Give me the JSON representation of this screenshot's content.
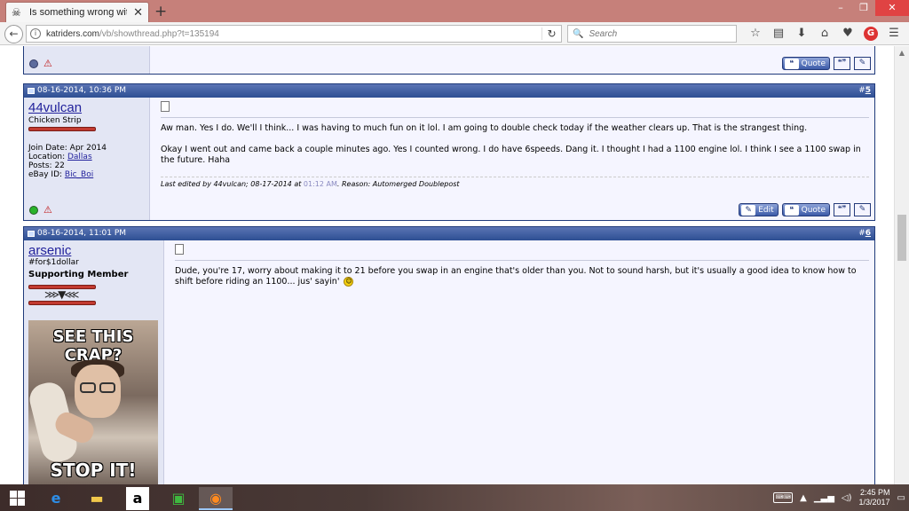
{
  "browser": {
    "tab_title": "Is something wrong with ...",
    "tab_close": "✕",
    "new_tab": "+",
    "url_host": "katriders.com",
    "url_path": "/vb/showthread.php?t=135194",
    "search_placeholder": "Search",
    "window_buttons": [
      "–",
      "❐",
      "✕"
    ]
  },
  "posts": [
    {
      "date": "08-16-2014, 10:36 PM",
      "number": "5",
      "number_prefix": "#",
      "username": "44vulcan",
      "user_title": "Chicken Strip",
      "join_date_label": "Join Date:",
      "join_date": "Apr 2014",
      "location_label": "Location:",
      "location": "Dallas",
      "posts_label": "Posts:",
      "posts": "22",
      "ebay_label": "eBay ID:",
      "ebay_id": "Bic_Boi",
      "paragraphs": [
        "Aw man. Yes I do. We'll I think... I was having to much fun on it lol. I am going to double check today if the weather clears up. That is the strangest thing.",
        "Okay I went out and came back a couple minutes ago. Yes I counted wrong. I do have 6speeds. Dang it. I thought I had a 1100 engine lol. I think I see a 1100 swap in the future. Haha"
      ],
      "edit_prefix": "Last edited by 44vulcan; 08-17-2014 at",
      "edit_time": "01:12 AM",
      "edit_suffix": ". Reason: Automerged Doublepost",
      "edit_button": "Edit",
      "quote_button": "Quote",
      "status": "online"
    },
    {
      "date": "08-16-2014, 11:01 PM",
      "number": "6",
      "number_prefix": "#",
      "username": "arsenic",
      "user_subtitle": "#for$1dollar",
      "user_title": "Supporting Member",
      "avatar_top": "SEE THIS CRAP?",
      "avatar_bottom": "STOP IT!",
      "text": "Dude, you're 17, worry about making it to 21 before you swap in an engine that's older than you. Not to sound harsh, but it's usually a good idea to know how to shift before riding an 1100... jus' sayin'",
      "smiley": "◕‿◕"
    }
  ],
  "previous_post": {
    "quote_button": "Quote",
    "status": "offline"
  },
  "taskbar": {
    "time": "2:45 PM",
    "date": "1/3/2017",
    "keyboard": "⌨",
    "tray_up": "▲"
  }
}
